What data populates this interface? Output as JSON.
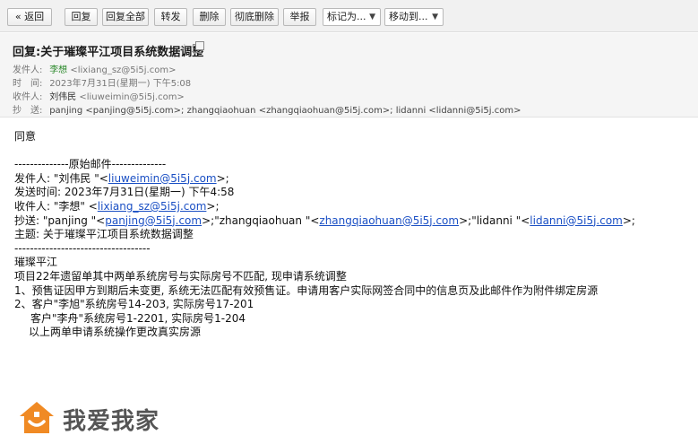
{
  "toolbar": {
    "back": "« 返回",
    "reply": "回复",
    "reply_all": "回复全部",
    "forward": "转发",
    "delete": "删除",
    "perm_delete": "彻底删除",
    "report": "举报",
    "mark_as": "标记为...",
    "move_to": "移动到..."
  },
  "header": {
    "subject": "回复:关于璀璨平江项目系统数据调整",
    "from_label": "发件人:",
    "from_name": "李想",
    "from_email": "<lixiang_sz@5i5j.com>",
    "time_label": "时　间:",
    "time_value": "2023年7月31日(星期一) 下午5:08",
    "to_label": "收件人:",
    "to_name": "刘伟民",
    "to_email": "<liuweimin@5i5j.com>",
    "cc_label": "抄　送:",
    "cc_value": "panjing <panjing@5i5j.com>; zhangqiaohuan <zhangqiaohuan@5i5j.com>; lidanni <lidanni@5i5j.com>"
  },
  "body": {
    "reply_text": "同意",
    "separator_top": "--------------原始邮件--------------",
    "from_prefix": "发件人: \"刘伟民 \"<",
    "from_link": "liuweimin@5i5j.com",
    "from_suffix": ">;",
    "sent_time": "发送时间: 2023年7月31日(星期一) 下午4:58",
    "to_prefix": "收件人: \"李想\" <",
    "to_link": "lixiang_sz@5i5j.com",
    "to_suffix": ">;",
    "cc_prefix": "抄送: \"panjing \"<",
    "cc_link1": "panjing@5i5j.com",
    "cc_mid1": ">;\"zhangqiaohuan \"<",
    "cc_link2": "zhangqiaohuan@5i5j.com",
    "cc_mid2": ">;\"lidanni \"<",
    "cc_link3": "lidanni@5i5j.com",
    "cc_suffix": ">;",
    "subject_line": "主题: 关于璀璨平江项目系统数据调整",
    "separator_bottom": "-----------------------------------",
    "project_name": "璀璨平江",
    "intro": "项目22年遗留单其中两单系统房号与实际房号不匹配, 现申请系统调整",
    "item1": "1、预售证因甲方到期后未变更, 系统无法匹配有效预售证。申请用客户实际网签合同中的信息页及此邮件作为附件绑定房源",
    "item2": "2、客户\"李旭\"系统房号14-203, 实际房号17-201",
    "item2b": "客户\"李舟\"系统房号1-2201, 实际房号1-204",
    "closing": "以上两单申请系统操作更改真实房源"
  },
  "watermark": {
    "text": "我爱我家"
  },
  "colors": {
    "toolbar_bg": "#f1f1f1",
    "header_bg": "#f5f5f5",
    "sender_green": "#2d8a2d",
    "link_blue": "#1a4fc4",
    "logo_orange": "#f08a24"
  }
}
